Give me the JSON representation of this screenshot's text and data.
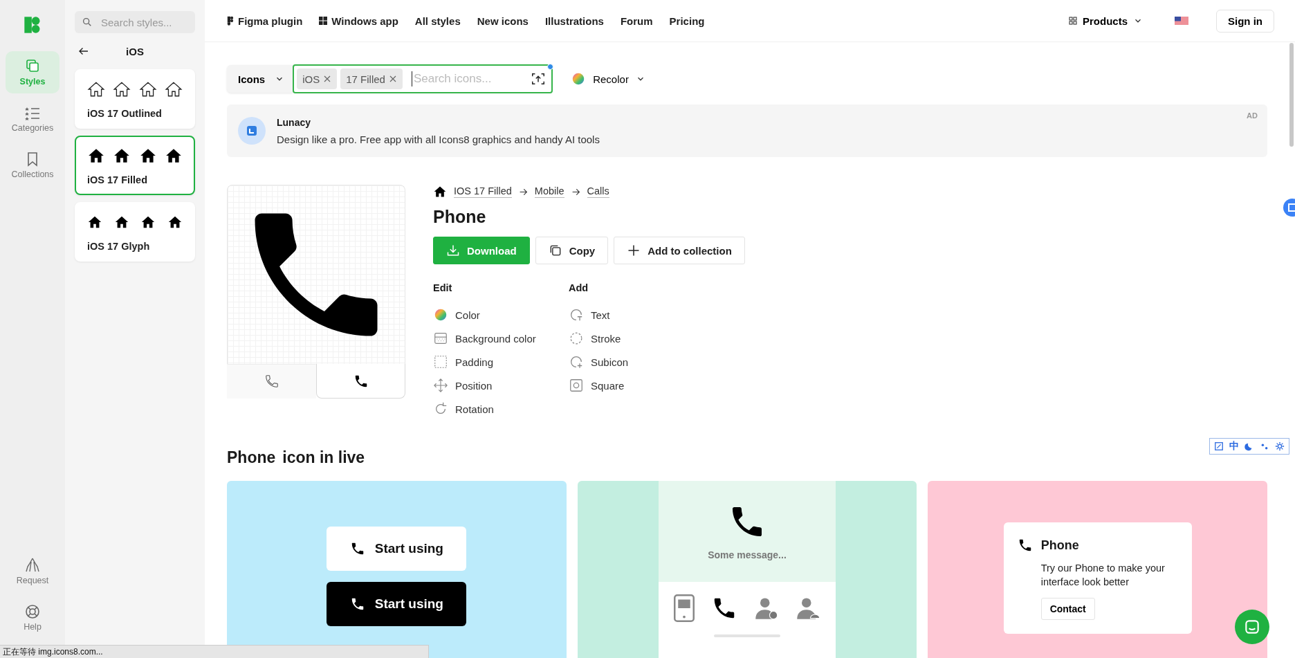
{
  "rail": {
    "items": [
      {
        "label": "Styles",
        "kind": "styles",
        "selected": true
      },
      {
        "label": "Categories",
        "kind": "categories",
        "selected": false
      },
      {
        "label": "Collections",
        "kind": "collections",
        "selected": false
      }
    ],
    "bottom_items": [
      {
        "label": "Request",
        "kind": "request"
      },
      {
        "label": "Help",
        "kind": "help"
      }
    ]
  },
  "styles_panel": {
    "placeholder": "Search styles...",
    "title": "iOS",
    "styles": [
      {
        "name": "iOS 17 Outlined",
        "kind": "outlined",
        "selected": false
      },
      {
        "name": "iOS 17 Filled",
        "kind": "filled",
        "selected": true
      },
      {
        "name": "iOS 17 Glyph",
        "kind": "glyph",
        "selected": false
      }
    ]
  },
  "nav": {
    "links": [
      {
        "label": "Figma plugin",
        "kind": "figma"
      },
      {
        "label": "Windows app",
        "kind": "windows"
      },
      {
        "label": "All styles",
        "kind": "plain"
      },
      {
        "label": "New icons",
        "kind": "plain"
      },
      {
        "label": "Illustrations",
        "kind": "plain"
      },
      {
        "label": "Forum",
        "kind": "plain"
      },
      {
        "label": "Pricing",
        "kind": "plain"
      }
    ],
    "products": "Products",
    "sign_in": "Sign in"
  },
  "search": {
    "category": "Icons",
    "tags": [
      "iOS",
      "17 Filled"
    ],
    "placeholder": "Search icons...",
    "recolor": "Recolor"
  },
  "ad": {
    "title": "Lunacy",
    "text": "Design like a pro. Free app with all Icons8 graphics and handy AI tools",
    "badge": "AD"
  },
  "icon": {
    "breadcrumbs": [
      "IOS 17 Filled",
      "Mobile",
      "Calls"
    ],
    "title": "Phone",
    "actions": [
      {
        "label": "Download",
        "kind": "download"
      },
      {
        "label": "Copy",
        "kind": "copy"
      },
      {
        "label": "Add to collection",
        "kind": "add"
      }
    ],
    "variants": [
      {
        "kind": "outline",
        "selected": false
      },
      {
        "kind": "filled",
        "selected": true
      }
    ],
    "edit": {
      "title": "Edit",
      "items": [
        {
          "label": "Color",
          "kind": "color"
        },
        {
          "label": "Background color",
          "kind": "background"
        },
        {
          "label": "Padding",
          "kind": "padding"
        },
        {
          "label": "Position",
          "kind": "position"
        },
        {
          "label": "Rotation",
          "kind": "rotation"
        }
      ]
    },
    "add": {
      "title": "Add",
      "items": [
        {
          "label": "Text",
          "kind": "text"
        },
        {
          "label": "Stroke",
          "kind": "stroke"
        },
        {
          "label": "Subicon",
          "kind": "subicon"
        },
        {
          "label": "Square",
          "kind": "square"
        }
      ]
    }
  },
  "live": {
    "title": "Phone",
    "subtitle": "icon in live",
    "cards": [
      {
        "kind": "buttons",
        "buttons": [
          "Start using",
          "Start using"
        ]
      },
      {
        "kind": "phone",
        "message": "Some message..."
      },
      {
        "kind": "card",
        "title": "Phone",
        "text": "Try our Phone to make your interface look better",
        "button": "Contact"
      }
    ]
  },
  "translate_toolbar": {
    "label": "中"
  },
  "status_bar": "正在等待 img.icons8.com..."
}
